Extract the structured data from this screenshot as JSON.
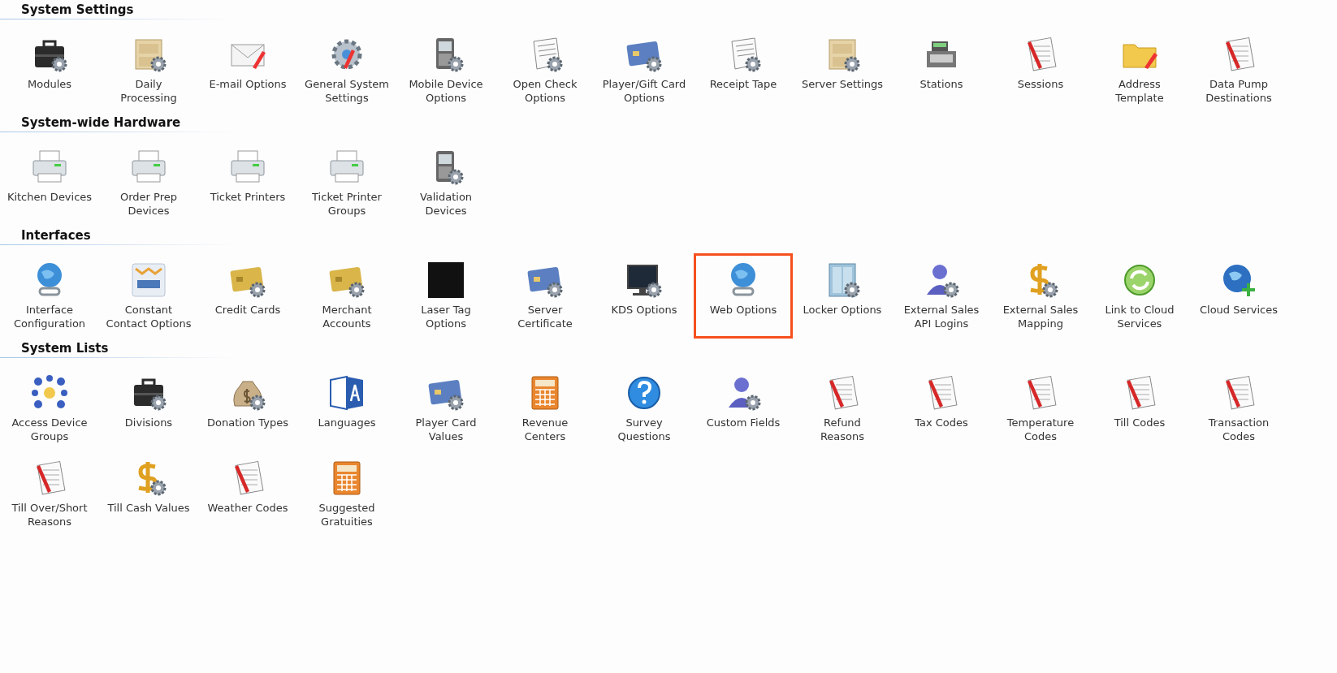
{
  "sections": [
    {
      "title": "System Settings",
      "items": [
        {
          "label": "Modules",
          "selected": false
        },
        {
          "label": "Daily\nProcessing",
          "selected": false
        },
        {
          "label": "E-mail Options",
          "selected": false
        },
        {
          "label": "General System\nSettings",
          "selected": false
        },
        {
          "label": "Mobile Device\nOptions",
          "selected": false
        },
        {
          "label": "Open Check\nOptions",
          "selected": false
        },
        {
          "label": "Player/Gift Card\nOptions",
          "selected": false
        },
        {
          "label": "Receipt Tape",
          "selected": false
        },
        {
          "label": "Server Settings",
          "selected": false
        },
        {
          "label": "Stations",
          "selected": false
        },
        {
          "label": "Sessions",
          "selected": false
        },
        {
          "label": "Address\nTemplate",
          "selected": false
        },
        {
          "label": "Data Pump\nDestinations",
          "selected": false
        }
      ]
    },
    {
      "title": "System-wide Hardware",
      "items": [
        {
          "label": "Kitchen Devices",
          "selected": false
        },
        {
          "label": "Order Prep\nDevices",
          "selected": false
        },
        {
          "label": "Ticket Printers",
          "selected": false
        },
        {
          "label": "Ticket Printer\nGroups",
          "selected": false
        },
        {
          "label": "Validation\nDevices",
          "selected": false
        }
      ]
    },
    {
      "title": "Interfaces",
      "items": [
        {
          "label": "Interface\nConfiguration",
          "selected": false
        },
        {
          "label": "Constant\nContact Options",
          "selected": false
        },
        {
          "label": "Credit Cards",
          "selected": false
        },
        {
          "label": "Merchant\nAccounts",
          "selected": false
        },
        {
          "label": "Laser Tag\nOptions",
          "selected": false
        },
        {
          "label": "Server\nCertificate",
          "selected": false
        },
        {
          "label": "KDS Options",
          "selected": false
        },
        {
          "label": "Web Options",
          "selected": true
        },
        {
          "label": "Locker Options",
          "selected": false
        },
        {
          "label": "External Sales\nAPI Logins",
          "selected": false
        },
        {
          "label": "External Sales\nMapping",
          "selected": false
        },
        {
          "label": "Link to Cloud\nServices",
          "selected": false
        },
        {
          "label": "Cloud Services",
          "selected": false
        }
      ]
    },
    {
      "title": "System Lists",
      "items": [
        {
          "label": "Access Device\nGroups",
          "selected": false
        },
        {
          "label": "Divisions",
          "selected": false
        },
        {
          "label": "Donation Types",
          "selected": false
        },
        {
          "label": "Languages",
          "selected": false
        },
        {
          "label": "Player Card\nValues",
          "selected": false
        },
        {
          "label": "Revenue\nCenters",
          "selected": false
        },
        {
          "label": "Survey\nQuestions",
          "selected": false
        },
        {
          "label": "Custom Fields",
          "selected": false
        },
        {
          "label": "Refund\nReasons",
          "selected": false
        },
        {
          "label": "Tax Codes",
          "selected": false
        },
        {
          "label": "Temperature\nCodes",
          "selected": false
        },
        {
          "label": "Till Codes",
          "selected": false
        },
        {
          "label": "Transaction\nCodes",
          "selected": false
        },
        {
          "label": "Till Over/Short\nReasons",
          "selected": false
        },
        {
          "label": "Till Cash Values",
          "selected": false
        },
        {
          "label": "Weather Codes",
          "selected": false
        },
        {
          "label": "Suggested\nGratuities",
          "selected": false
        }
      ]
    }
  ]
}
